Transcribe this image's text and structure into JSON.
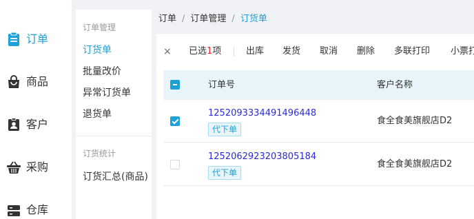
{
  "main_nav": {
    "items": [
      {
        "label": "订单",
        "icon": "clipboard-icon",
        "active": true
      },
      {
        "label": "商品",
        "icon": "shopping-bag-icon",
        "active": false
      },
      {
        "label": "客户",
        "icon": "contact-card-icon",
        "active": false
      },
      {
        "label": "采购",
        "icon": "basket-icon",
        "active": false
      },
      {
        "label": "仓库",
        "icon": "warehouse-icon",
        "active": false
      }
    ]
  },
  "sub_nav": {
    "group1_title": "订单管理",
    "group1_items": [
      "订货单",
      "批量改价",
      "异常订货单",
      "退货单"
    ],
    "group2_title": "订货统计",
    "group2_items": [
      "订货汇总(商品)"
    ]
  },
  "breadcrumb": {
    "items": [
      "订单",
      "订单管理",
      "订货单"
    ],
    "separator": "/"
  },
  "toolbar": {
    "close_symbol": "×",
    "selected_prefix": "已选",
    "selected_count": "1",
    "selected_suffix": "项",
    "actions": [
      "出库",
      "发货",
      "取消",
      "删除",
      "多联打印",
      "小票打印"
    ]
  },
  "table": {
    "columns": [
      "订单号",
      "客户名称"
    ],
    "rows": [
      {
        "order_no": "1252093334491496448",
        "tag": "代下单",
        "customer": "食全食美旗舰店D2",
        "checked": true
      },
      {
        "order_no": "1252062923203805184",
        "tag": "代下单",
        "customer": "食全食美旗舰店D2",
        "checked": false
      }
    ]
  },
  "colors": {
    "accent": "#1da1d8",
    "order_link": "#2b2bd6",
    "header_bg": "#e8f6fb",
    "selected_count": "#f5222d"
  }
}
